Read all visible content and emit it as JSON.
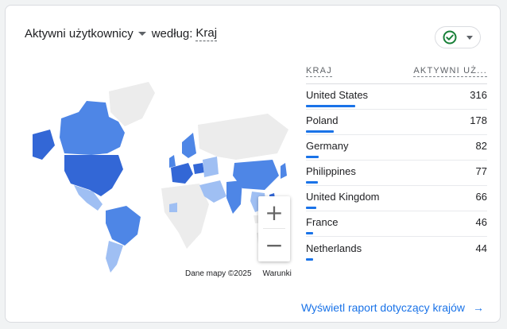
{
  "header": {
    "metric": "Aktywni użytkownicy",
    "by": "według:",
    "dimension": "Kraj"
  },
  "status": {
    "icon": "check-circle-icon",
    "color": "#188038"
  },
  "table": {
    "col_country": "KRAJ",
    "col_value": "AKTYWNI UŻ...",
    "max_value": 316,
    "rows": [
      {
        "country": "United States",
        "value": 316
      },
      {
        "country": "Poland",
        "value": 178
      },
      {
        "country": "Germany",
        "value": 82
      },
      {
        "country": "Philippines",
        "value": 77
      },
      {
        "country": "United Kingdom",
        "value": 66
      },
      {
        "country": "France",
        "value": 46
      },
      {
        "country": "Netherlands",
        "value": 44
      }
    ]
  },
  "map": {
    "footer_data": "Dane mapy ©2025",
    "footer_terms": "Warunki",
    "zoom_in": "+",
    "zoom_out": "−",
    "colors": {
      "dark": "#3367d6",
      "mid": "#4e86e6",
      "light": "#9fbff3",
      "none": "#ececec"
    }
  },
  "footer": {
    "report_link": "Wyświetl raport dotyczący krajów",
    "arrow": "→"
  }
}
